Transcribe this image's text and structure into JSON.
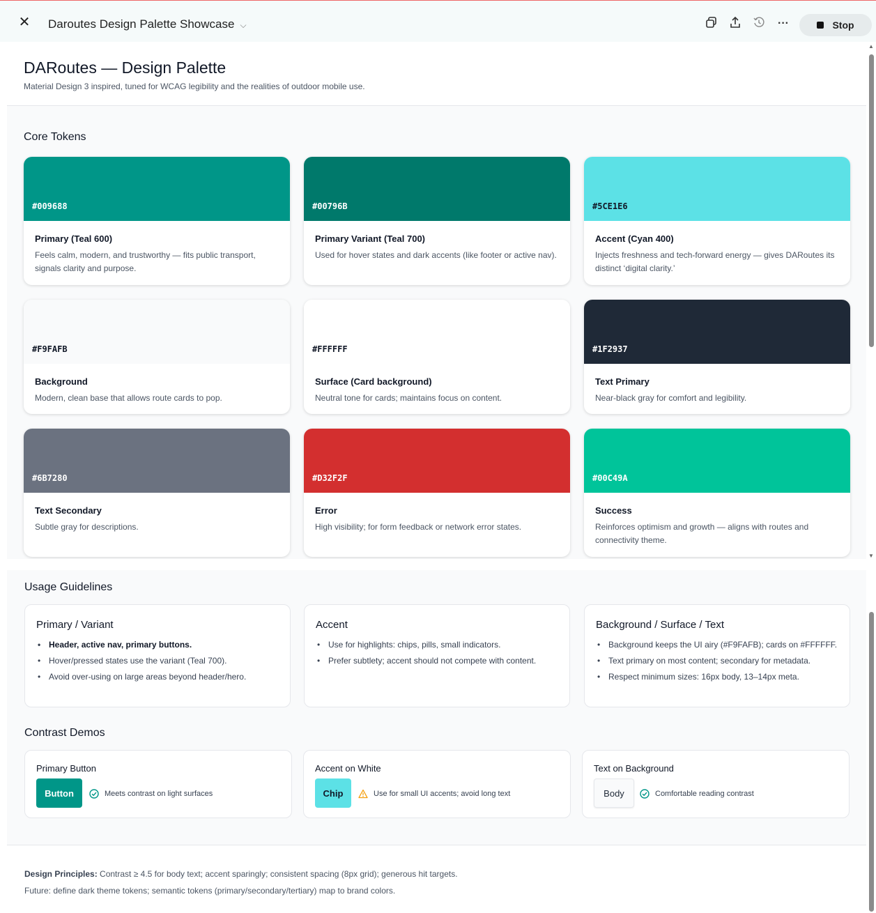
{
  "window": {
    "title": "Daroutes Design Palette Showcase",
    "stop_label": "Stop",
    "icons": [
      "close-icon",
      "chevron-down-icon",
      "copy-icon",
      "share-icon",
      "history-icon",
      "more-icon",
      "stop-icon"
    ]
  },
  "header": {
    "title": "DARoutes — Design Palette",
    "subtitle": "Material Design 3 inspired, tuned for WCAG legibility and the realities of outdoor mobile use."
  },
  "core": {
    "title": "Core Tokens",
    "tokens": [
      {
        "hex": "#009688",
        "name": "Primary (Teal 600)",
        "desc": "Feels calm, modern, and trustworthy — fits public transport, signals clarity and purpose.",
        "text_color": "#ffffff"
      },
      {
        "hex": "#00796B",
        "name": "Primary Variant (Teal 700)",
        "desc": "Used for hover states and dark accents (like footer or active nav).",
        "text_color": "#ffffff"
      },
      {
        "hex": "#5CE1E6",
        "name": "Accent (Cyan 400)",
        "desc": "Injects freshness and tech-forward energy — gives DARoutes its distinct ‘digital clarity.’",
        "text_color": "#111827"
      },
      {
        "hex": "#F9FAFB",
        "name": "Background",
        "desc": "Modern, clean base that allows route cards to pop.",
        "text_color": "#111827"
      },
      {
        "hex": "#FFFFFF",
        "name": "Surface (Card background)",
        "desc": "Neutral tone for cards; maintains focus on content.",
        "text_color": "#111827"
      },
      {
        "hex": "#1F2937",
        "name": "Text Primary",
        "desc": "Near-black gray for comfort and legibility.",
        "text_color": "#ffffff"
      },
      {
        "hex": "#6B7280",
        "name": "Text Secondary",
        "desc": "Subtle gray for descriptions.",
        "text_color": "#ffffff"
      },
      {
        "hex": "#D32F2F",
        "name": "Error",
        "desc": "High visibility; for form feedback or network error states.",
        "text_color": "#ffffff"
      },
      {
        "hex": "#00C49A",
        "name": "Success",
        "desc": "Reinforces optimism and growth — aligns with routes and connectivity theme.",
        "text_color": "#ffffff"
      }
    ]
  },
  "usage": {
    "title": "Usage Guidelines",
    "cards": [
      {
        "title": "Primary / Variant",
        "items": [
          "Header, active nav, primary buttons.",
          "Hover/pressed states use the variant (Teal 700).",
          "Avoid over-using on large areas beyond header/hero."
        ]
      },
      {
        "title": "Accent",
        "items": [
          "Use for highlights: chips, pills, small indicators.",
          "Prefer subtlety; accent should not compete with content."
        ]
      },
      {
        "title": "Background / Surface / Text",
        "items": [
          "Background keeps the UI airy (#F9FAFB); cards on #FFFFFF.",
          "Text primary on most content; secondary for metadata.",
          "Respect minimum sizes: 16px body, 13–14px meta."
        ]
      }
    ]
  },
  "contrast": {
    "title": "Contrast Demos",
    "demos": [
      {
        "title": "Primary Button",
        "sample": "Button",
        "note": "Meets contrast on light surfaces",
        "bg": "#009688",
        "fg": "#ffffff",
        "status": "check-circle-icon",
        "status_color": "#009688"
      },
      {
        "title": "Accent on White",
        "sample": "Chip",
        "note": "Use for small UI accents; avoid long text",
        "bg": "#5CE1E6",
        "fg": "#111827",
        "status": "warning-icon",
        "status_color": "#F59E0B"
      },
      {
        "title": "Text on Background",
        "sample": "Body",
        "note": "Comfortable reading contrast",
        "bg": "#F9FAFB",
        "fg": "#1F2937",
        "status": "check-circle-icon",
        "status_color": "#009688"
      }
    ]
  },
  "footer": {
    "principles_label": "Design Principles:",
    "principles_text": " Contrast ≥ 4.5 for body text; accent sparingly; consistent spacing (8px grid); generous hit targets.",
    "future_text": "Future: define dark theme tokens; semantic tokens (primary/secondary/tertiary) map to brand colors."
  }
}
